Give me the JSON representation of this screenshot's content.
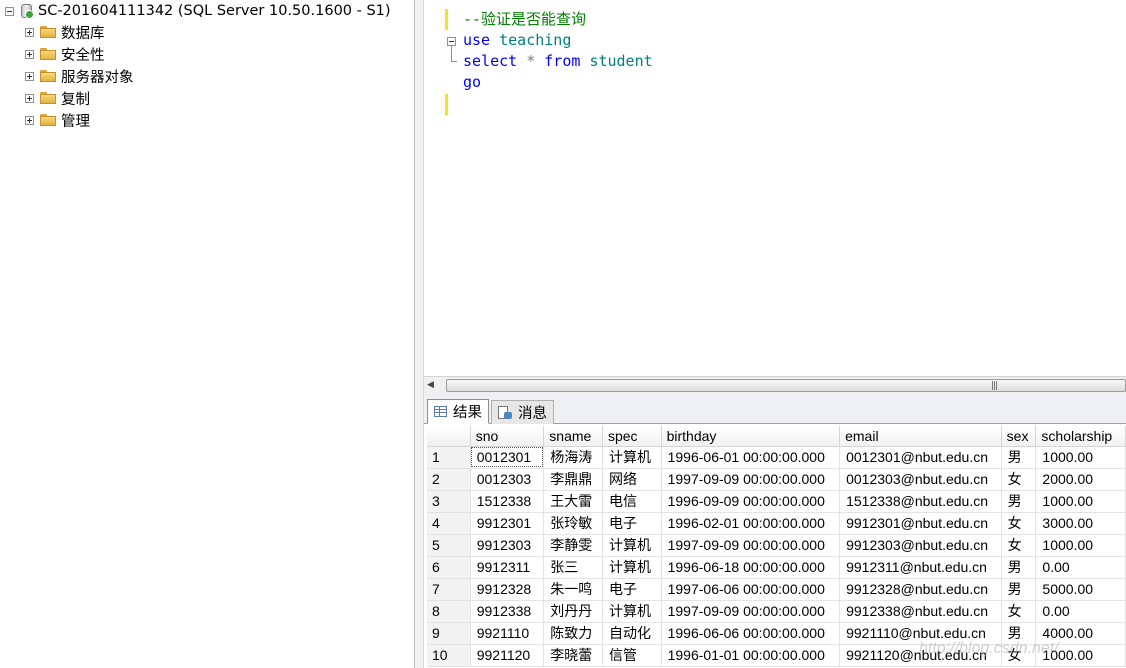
{
  "explorer": {
    "server_label": "SC-201604111342 (SQL Server 10.50.1600 - S1)",
    "nodes": [
      {
        "label": "数据库",
        "icon": "folder-icon"
      },
      {
        "label": "安全性",
        "icon": "folder-icon"
      },
      {
        "label": "服务器对象",
        "icon": "folder-icon"
      },
      {
        "label": "复制",
        "icon": "folder-icon"
      },
      {
        "label": "管理",
        "icon": "folder-icon"
      }
    ]
  },
  "editor": {
    "lines": [
      {
        "comment": "--验证是否能查询"
      },
      {
        "kw1": "use",
        "id1": "teaching"
      },
      {
        "kw1": "select",
        "op": "*",
        "kw2": "from",
        "id1": "student"
      },
      {
        "kw1": "go"
      }
    ]
  },
  "results": {
    "tabs": [
      {
        "label": "结果",
        "icon": "grid-icon",
        "active": true
      },
      {
        "label": "消息",
        "icon": "message-icon",
        "active": false
      }
    ],
    "columns": [
      "sno",
      "sname",
      "spec",
      "birthday",
      "email",
      "sex",
      "scholarship"
    ],
    "rows": [
      [
        "1",
        "0012301",
        "杨海涛",
        "计算机",
        "1996-06-01 00:00:00.000",
        "0012301@nbut.edu.cn",
        "男",
        "1000.00"
      ],
      [
        "2",
        "0012303",
        "李鼎鼎",
        "网络",
        "1997-09-09 00:00:00.000",
        "0012303@nbut.edu.cn",
        "女",
        "2000.00"
      ],
      [
        "3",
        "1512338",
        "王大雷",
        "电信",
        "1996-09-09 00:00:00.000",
        "1512338@nbut.edu.cn",
        "男",
        "1000.00"
      ],
      [
        "4",
        "9912301",
        "张玲敏",
        "电子",
        "1996-02-01 00:00:00.000",
        "9912301@nbut.edu.cn",
        "女",
        "3000.00"
      ],
      [
        "5",
        "9912303",
        "李静雯",
        "计算机",
        "1997-09-09 00:00:00.000",
        "9912303@nbut.edu.cn",
        "女",
        "1000.00"
      ],
      [
        "6",
        "9912311",
        "张三",
        "计算机",
        "1996-06-18 00:00:00.000",
        "9912311@nbut.edu.cn",
        "男",
        "0.00"
      ],
      [
        "7",
        "9912328",
        "朱一鸣",
        "电子",
        "1997-06-06 00:00:00.000",
        "9912328@nbut.edu.cn",
        "男",
        "5000.00"
      ],
      [
        "8",
        "9912338",
        "刘丹丹",
        "计算机",
        "1997-09-09 00:00:00.000",
        "9912338@nbut.edu.cn",
        "女",
        "0.00"
      ],
      [
        "9",
        "9921110",
        "陈致力",
        "自动化",
        "1996-06-06 00:00:00.000",
        "9921110@nbut.edu.cn",
        "男",
        "4000.00"
      ],
      [
        "10",
        "9921120",
        "李晓蕾",
        "信管",
        "1996-01-01 00:00:00.000",
        "9921120@nbut.edu.cn",
        "女",
        "1000.00"
      ]
    ]
  },
  "watermark": "http://blog.csdn.net/"
}
